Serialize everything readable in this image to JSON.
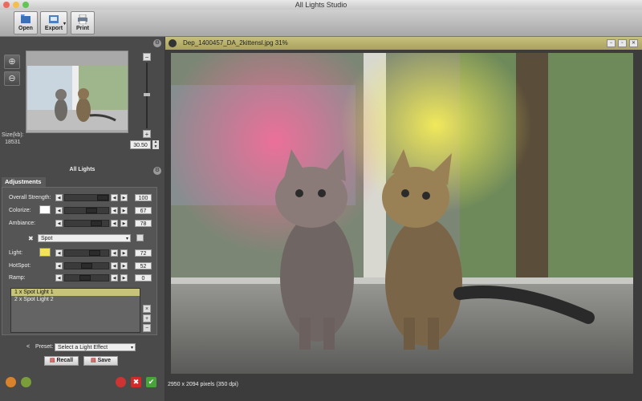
{
  "window": {
    "title": "All Lights Studio"
  },
  "toolbar": {
    "open_label": "Open",
    "export_label": "Export",
    "print_label": "Print"
  },
  "navigator": {
    "size_label": "Size(kb):",
    "size_value": "18531",
    "zoom_value": "30.50"
  },
  "adjustments": {
    "section_title": "All Lights",
    "tab_label": "Adjustments",
    "overall_strength": {
      "label": "Overall Strength:",
      "value": "100"
    },
    "colorize": {
      "label": "Colorize:",
      "value": "67",
      "swatch": "#ffffff"
    },
    "ambiance": {
      "label": "Ambiance:",
      "value": "78"
    },
    "light_type": "Spot",
    "light": {
      "label": "Light:",
      "value": "72",
      "swatch": "#f2e35a"
    },
    "hotspot": {
      "label": "HotSpot:",
      "value": "52"
    },
    "ramp": {
      "label": "Ramp:",
      "value": "0"
    },
    "lights": [
      {
        "label": "1   x Spot Light 1",
        "selected": true
      },
      {
        "label": "2   x Spot Light 2",
        "selected": false
      }
    ]
  },
  "preset": {
    "label": "Preset:",
    "value": "Select a Light Effect"
  },
  "buttons": {
    "recall_label": "Recall",
    "save_label": "Save"
  },
  "image": {
    "filename": "Dep_1400457_DA_2kittensl.jpg 31%",
    "status": "2950 x 2094 pixels (350 dpi)"
  },
  "colors": {
    "header_bar": "#bfb871",
    "selection": "#c7c37a",
    "light_swatch": "#f2e35a"
  }
}
